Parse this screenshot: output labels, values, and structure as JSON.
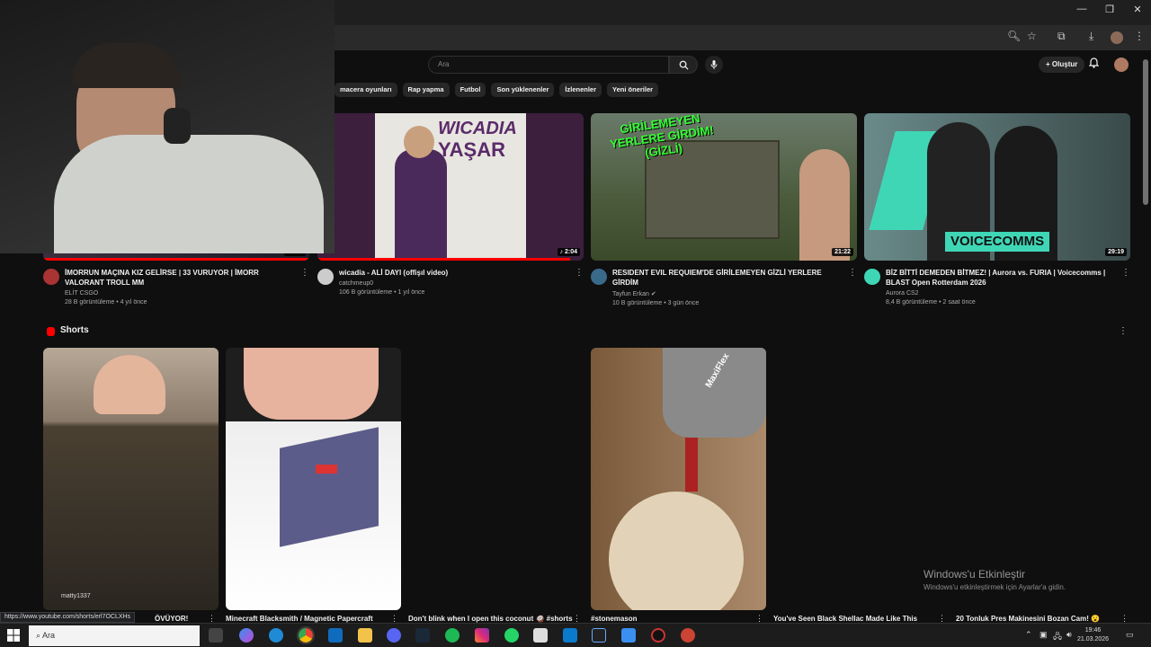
{
  "browser": {
    "window_controls": [
      "—",
      "❐",
      "✕"
    ]
  },
  "header": {
    "search_placeholder": "Ara",
    "create_label": "Oluştur",
    "create_icon": "plus-icon"
  },
  "chips": [
    "macera oyunları",
    "Rap yapma",
    "Futbol",
    "Son yüklenenler",
    "İzlenenler",
    "Yeni öneriler"
  ],
  "videos": [
    {
      "title": "İMORRUN MAÇINA KIZ GELİRSE | 33 VURUYOR | İMORR VALORANT TROLL MM",
      "channel": "ELİT CSGO",
      "stats": "28 B görüntüleme • 4 yıl önce",
      "duration": "33:54",
      "progress": 1.0
    },
    {
      "title": "wicadia - ALİ DAYI (offişıl video)",
      "channel": "catchmeup0",
      "stats": "106 B görüntüleme • 1 yıl önce",
      "duration": "2:04",
      "progress": 0.95,
      "thumb_title": "WICADIA",
      "thumb_sub": "YAŞAR"
    },
    {
      "title": "RESIDENT EVIL REQUIEM'DE GİRİLEMEYEN GİZLİ YERLERE GİRDİM",
      "channel": "Tayfun Erkan",
      "stats": "10 B görüntüleme • 3 gün önce",
      "duration": "21:22",
      "progress": 0.0,
      "thumb_text": "GİRİLEMEYEN YERLERE GİRDİM! (GİZLİ)"
    },
    {
      "title": "BİZ BİTTİ DEMEDEN BİTMEZ! | Aurora vs. FURIA | Voicecomms | BLAST Open Rotterdam 2026",
      "channel": "Aurora CS2",
      "stats": "8,4 B görüntüleme • 2 saat önce",
      "duration": "29:19",
      "progress": 0.0,
      "thumb_text": "VOICECOMMS"
    }
  ],
  "shorts": {
    "heading": "Shorts",
    "items": [
      {
        "title": "ÖVÜYOR!",
        "overlay": "matty1337"
      },
      {
        "title": "Minecraft Blacksmith / Magnetic Papercraft"
      },
      {
        "title": "Don't blink when I open this coconut 🥥 #shorts"
      },
      {
        "title": "#stonemason",
        "glove_text": "MaxiFlex"
      },
      {
        "title": "You've Seen Black Shellac Made Like This"
      },
      {
        "title": "20 Tonluk Pres Makinesini Bozan Cam! 😮"
      }
    ]
  },
  "status_url": "https://www.youtube.com/shorts/erl7OCLXHs",
  "watermark": {
    "line1": "Windows'u Etkinleştir",
    "line2": "Windows'u etkinleştirmek için Ayarlar'a gidin."
  },
  "taskbar": {
    "search_placeholder": "Ara",
    "time": "19:46",
    "date": "21.03.2026"
  },
  "colors": {
    "background": "#0f0f0f",
    "accent_red": "#ff0000",
    "chip_bg": "#272727"
  }
}
